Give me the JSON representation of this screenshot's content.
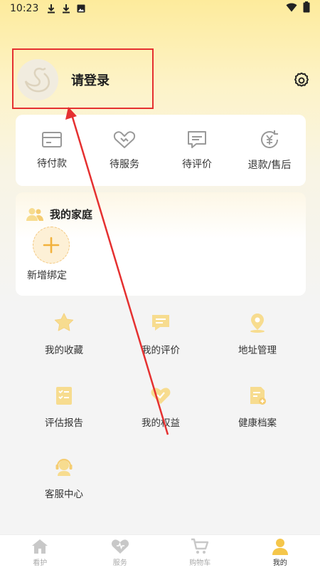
{
  "status_bar": {
    "time": "10:23"
  },
  "profile": {
    "login_label": "请登录"
  },
  "orders": [
    {
      "label": "待付款",
      "icon": "wallet-icon"
    },
    {
      "label": "待服务",
      "icon": "handshake-icon"
    },
    {
      "label": "待评价",
      "icon": "comment-icon"
    },
    {
      "label": "退款/售后",
      "icon": "refund-icon"
    }
  ],
  "family": {
    "title": "我的家庭",
    "add_label": "新增绑定"
  },
  "menu": [
    {
      "label": "我的收藏",
      "icon": "star-icon"
    },
    {
      "label": "我的评价",
      "icon": "message-icon"
    },
    {
      "label": "地址管理",
      "icon": "location-icon"
    },
    {
      "label": "评估报告",
      "icon": "report-icon"
    },
    {
      "label": "我的权益",
      "icon": "heart-check-icon"
    },
    {
      "label": "健康档案",
      "icon": "health-file-icon"
    },
    {
      "label": "客服中心",
      "icon": "headset-icon"
    }
  ],
  "tabbar": [
    {
      "label": "看护",
      "icon": "home-icon"
    },
    {
      "label": "服务",
      "icon": "heart-icon"
    },
    {
      "label": "购物车",
      "icon": "cart-icon"
    },
    {
      "label": "我的",
      "icon": "user-icon"
    }
  ],
  "colors": {
    "accent": "#f5c64a",
    "icon_light": "#f7dc8f",
    "annotation": "#e53030"
  }
}
